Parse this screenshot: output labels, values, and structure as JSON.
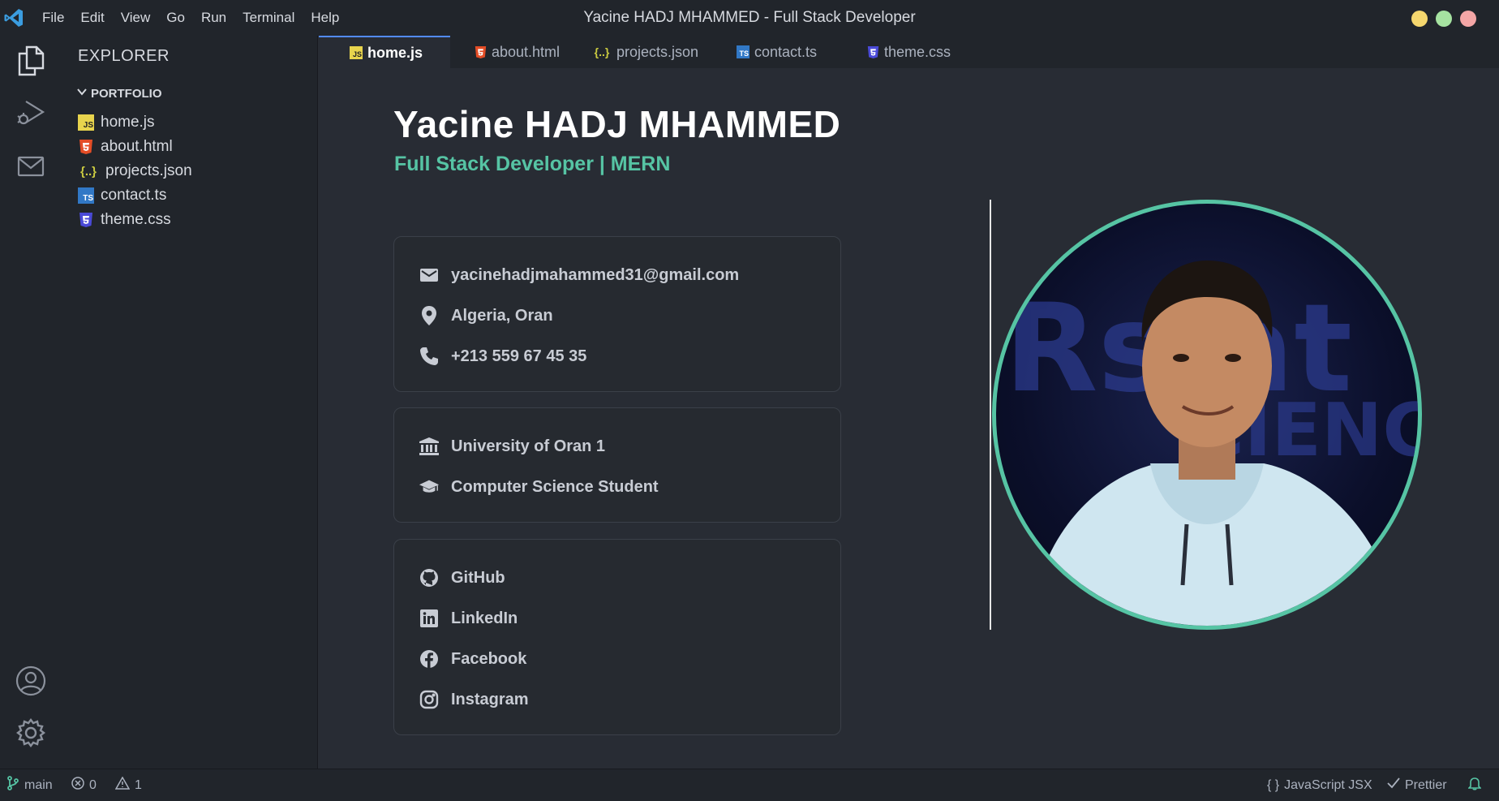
{
  "titlebar": {
    "menu": [
      "File",
      "Edit",
      "View",
      "Go",
      "Run",
      "Terminal",
      "Help"
    ],
    "title": "Yacine HADJ MHAMMED - Full Stack Developer",
    "controls": [
      "#f5d76e",
      "#a6e3a1",
      "#f4a6a6"
    ]
  },
  "activity": {
    "icons": [
      "files-icon",
      "run-debug-icon",
      "mail-icon",
      "account-icon",
      "settings-icon"
    ]
  },
  "sidebar": {
    "title": "EXPLORER",
    "folder": "PORTFOLIO",
    "files": [
      {
        "name": "home.js",
        "icon": "js-file-icon"
      },
      {
        "name": "about.html",
        "icon": "html-file-icon"
      },
      {
        "name": "projects.json",
        "icon": "json-file-icon"
      },
      {
        "name": "contact.ts",
        "icon": "ts-file-icon"
      },
      {
        "name": "theme.css",
        "icon": "css-file-icon"
      }
    ]
  },
  "tabs": [
    {
      "label": "home.js",
      "active": true
    },
    {
      "label": "about.html"
    },
    {
      "label": "projects.json"
    },
    {
      "label": "contact.ts"
    },
    {
      "label": "theme.css"
    }
  ],
  "profile": {
    "name": "Yacine HADJ MHAMMED",
    "role": "Full Stack Developer | MERN",
    "contact": {
      "email": "yacinehadjmahammed31@gmail.com",
      "location": "Algeria, Oran",
      "phone": "+213 559 67 45 35"
    },
    "education": {
      "university": "University of Oran 1",
      "degree": "Computer Science Student"
    },
    "social": [
      "GitHub",
      "LinkedIn",
      "Facebook",
      "Instagram"
    ],
    "accent": "#56c4a4"
  },
  "statusbar": {
    "branch": "main",
    "errors": "0",
    "warnings": "1",
    "language": "JavaScript JSX",
    "formatter": "Prettier"
  }
}
